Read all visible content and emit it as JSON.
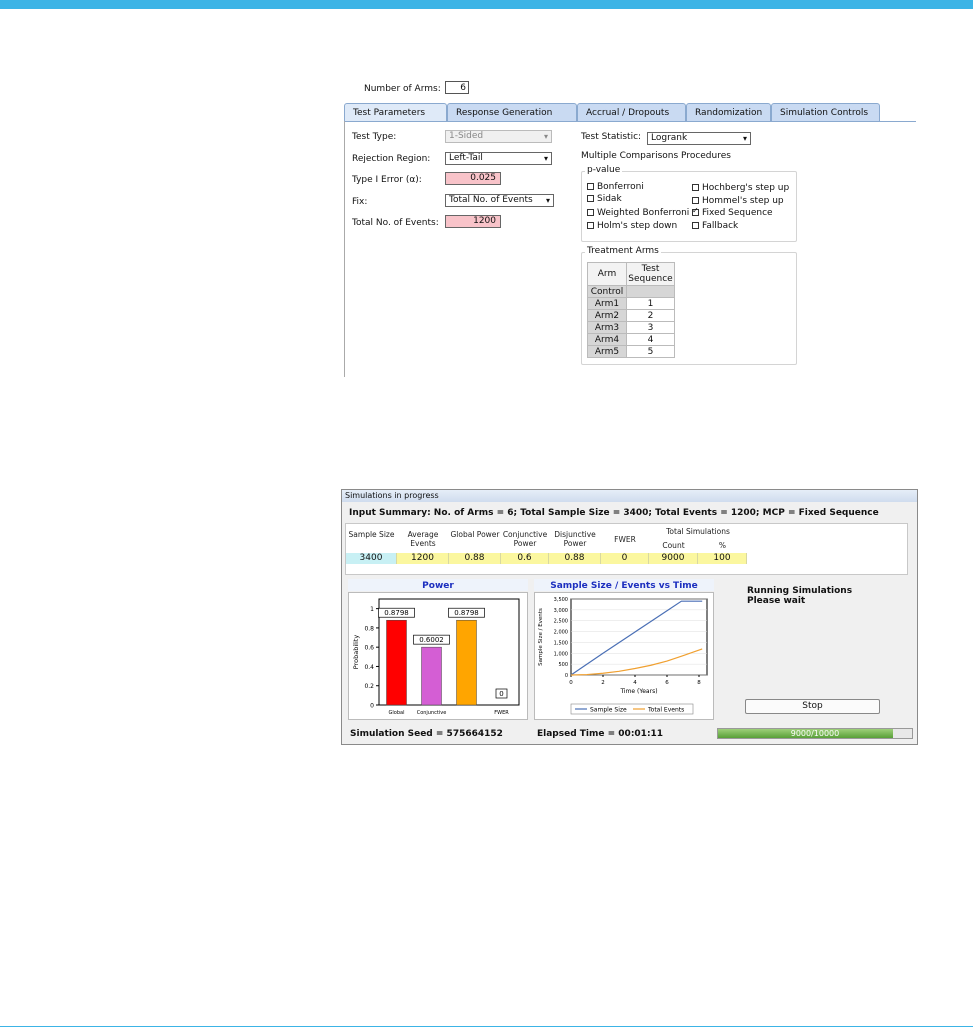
{
  "top": {
    "arms_label": "Number of Arms:",
    "arms_value": "6",
    "tabs": [
      {
        "label": "Test Parameters"
      },
      {
        "label": "Response Generation"
      },
      {
        "label": "Accrual / Dropouts"
      },
      {
        "label": "Randomization"
      },
      {
        "label": "Simulation Controls"
      }
    ],
    "test_type_label": "Test Type:",
    "test_type_value": "1-Sided",
    "rejection_label": "Rejection Region:",
    "rejection_value": "Left-Tail",
    "type1_label": "Type I Error (α):",
    "type1_value": "0.025",
    "fix_label": "Fix:",
    "fix_value": "Total No. of Events",
    "events_label": "Total No. of Events:",
    "events_value": "1200",
    "test_stat_label": "Test Statistic:",
    "test_stat_value": "Logrank",
    "mcp_label": "Multiple Comparisons Procedures",
    "pvalue_label": "p-value",
    "pvalue_options": [
      {
        "label": "Bonferroni",
        "checked": false
      },
      {
        "label": "Sidak",
        "checked": false
      },
      {
        "label": "Weighted Bonferroni",
        "checked": false
      },
      {
        "label": "Holm's step down",
        "checked": false
      },
      {
        "label": "Hochberg's step up",
        "checked": false
      },
      {
        "label": "Hommel's step up",
        "checked": false
      },
      {
        "label": "Fixed Sequence",
        "checked": true
      },
      {
        "label": "Fallback",
        "checked": false
      }
    ],
    "treatment_label": "Treatment Arms",
    "arms_table": {
      "header_arm": "Arm",
      "header_seq": "Test Sequence",
      "rows": [
        {
          "arm": "Control",
          "seq": ""
        },
        {
          "arm": "Arm1",
          "seq": "1"
        },
        {
          "arm": "Arm2",
          "seq": "2"
        },
        {
          "arm": "Arm3",
          "seq": "3"
        },
        {
          "arm": "Arm4",
          "seq": "4"
        },
        {
          "arm": "Arm5",
          "seq": "5"
        }
      ]
    }
  },
  "sim": {
    "title": "Simulations in progress",
    "summary": "Input Summary: No. of Arms = 6; Total Sample Size = 3400; Total Events = 1200; MCP = Fixed Sequence",
    "table": {
      "headers": [
        "Sample Size",
        "Average Events",
        "Global Power",
        "Conjunctive Power",
        "Disjunctive Power",
        "FWER"
      ],
      "total_sims": "Total Simulations",
      "count": "Count",
      "pct": "%",
      "values": [
        "3400",
        "1200",
        "0.88",
        "0.6",
        "0.88",
        "0",
        "9000",
        "100"
      ]
    },
    "running": "Running Simulations",
    "please_wait": "Please wait",
    "stop": "Stop",
    "seed": "Simulation Seed = 575664152",
    "elapsed": "Elapsed Time = 00:01:11",
    "progress_text": "9000/10000",
    "progress_fraction": 0.9
  },
  "chart_data": [
    {
      "type": "bar",
      "title": "Power",
      "ylabel": "Probability",
      "categories": [
        "Global",
        "Conjunctive",
        "",
        "FWER"
      ],
      "values": [
        0.8798,
        0.6002,
        0.8798,
        0
      ],
      "labels": [
        "0.8798",
        "0.6002",
        "0.8798",
        "0"
      ],
      "colors": [
        "#ff0000",
        "#d45ed4",
        "#ffa500",
        "#000000"
      ],
      "ylim": [
        0,
        1.1
      ],
      "yticks": [
        "0",
        "0.2",
        "0.4",
        "0.6",
        "0.8",
        "1"
      ]
    },
    {
      "type": "line",
      "title": "Sample Size / Events vs Time",
      "xlabel": "Time (Years)",
      "ylabel": "Sample Size / Events",
      "xlim": [
        0,
        8.5
      ],
      "ylim": [
        0,
        3500
      ],
      "xticks": [
        "0",
        "2",
        "4",
        "6",
        "8"
      ],
      "yticks": [
        "0",
        "500",
        "1,000",
        "1,500",
        "2,000",
        "2,500",
        "3,000",
        "3,500"
      ],
      "series": [
        {
          "name": "Sample Size",
          "color": "#4a6fb5",
          "x": [
            0,
            1,
            2,
            3,
            4,
            5,
            6,
            6.9,
            8.2
          ],
          "y": [
            0,
            500,
            1000,
            1490,
            1980,
            2470,
            2960,
            3400,
            3400
          ]
        },
        {
          "name": "Total Events",
          "color": "#f0a030",
          "x": [
            0,
            1,
            2,
            3,
            4,
            5,
            6,
            7,
            8.2
          ],
          "y": [
            0,
            20,
            80,
            170,
            300,
            450,
            640,
            890,
            1200
          ]
        }
      ]
    }
  ]
}
